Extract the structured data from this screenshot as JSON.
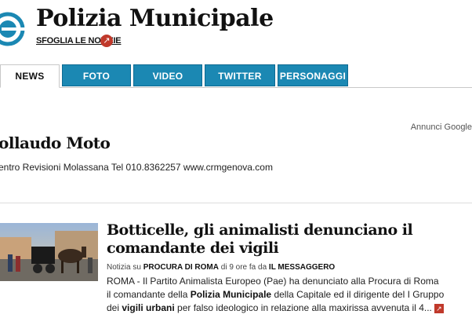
{
  "header": {
    "title": "Polizia Municipale",
    "browse_link": "SFOGLIA LE NOTIZIE",
    "accent": "#1b88b3",
    "logo": "teal-ring-logo"
  },
  "tabs": [
    {
      "label": "NEWS",
      "active": true
    },
    {
      "label": "FOTO",
      "active": false
    },
    {
      "label": "VIDEO",
      "active": false
    },
    {
      "label": "TWITTER",
      "active": false
    },
    {
      "label": "PERSONAGGI",
      "active": false
    }
  ],
  "ad": {
    "label": "Annunci Google",
    "title": "ollaudo Moto",
    "text": "entro Revisioni Molassana Tel 010.8362257 www.crmgenova.com"
  },
  "article": {
    "headline_line1": "Botticelle, gli animalisti denunciano il",
    "headline_line2": "comandante dei vigili",
    "meta_prefix": "Notizia su",
    "meta_topic": "PROCURA DI ROMA",
    "meta_time": "di 9 ore fa da",
    "meta_source": "IL MESSAGGERO",
    "summary_line1": "ROMA - Il Partito Animalista Europeo (Pae) ha denunciato alla Procura di Roma",
    "summary_line2_a": "il comandante della",
    "summary_line2_b": "Polizia Municipale",
    "summary_line2_c": "della Capitale ed il dirigente del I Gruppo",
    "summary_line3_a": "dei",
    "summary_line3_b": "vigili urbani",
    "summary_line3_c": "per falso ideologico in relazione alla maxirissa avvenuta il 4...",
    "brand_red": "#c0392b"
  }
}
